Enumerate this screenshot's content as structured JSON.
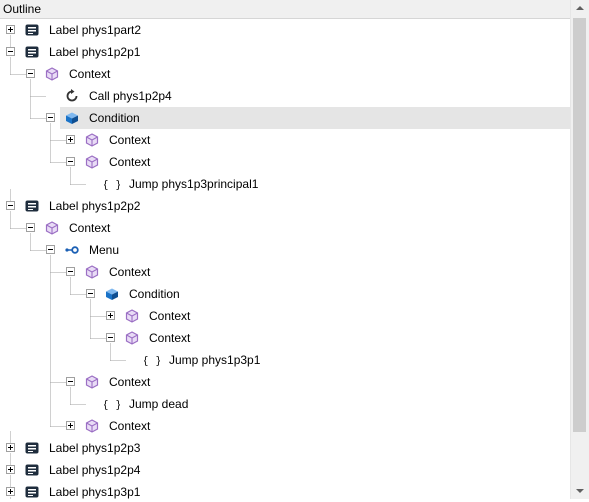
{
  "panel": {
    "title": "Outline"
  },
  "tree": {
    "rows": [
      {
        "label": "Label phys1part2",
        "icon": "label-icon",
        "expander": "plus",
        "depth": 0
      },
      {
        "label": "Label phys1p2p1",
        "icon": "label-icon",
        "expander": "minus",
        "depth": 0
      },
      {
        "label": "Context",
        "icon": "context-icon",
        "expander": "minus",
        "depth": 1
      },
      {
        "label": "Call phys1p2p4",
        "icon": "call-icon",
        "expander": "none",
        "depth": 2
      },
      {
        "label": "Condition",
        "icon": "condition-icon",
        "expander": "minus",
        "depth": 2,
        "selected": true
      },
      {
        "label": "Context",
        "icon": "context-icon",
        "expander": "plus",
        "depth": 3
      },
      {
        "label": "Context",
        "icon": "context-icon",
        "expander": "minus",
        "depth": 3
      },
      {
        "label": "Jump phys1p3principal1",
        "icon": "jump-icon",
        "expander": "none",
        "depth": 4
      },
      {
        "label": "Label phys1p2p2",
        "icon": "label-icon",
        "expander": "minus",
        "depth": 0
      },
      {
        "label": "Context",
        "icon": "context-icon",
        "expander": "minus",
        "depth": 1
      },
      {
        "label": "Menu",
        "icon": "menu-icon",
        "expander": "minus",
        "depth": 2
      },
      {
        "label": "Context",
        "icon": "context-icon",
        "expander": "minus",
        "depth": 3
      },
      {
        "label": "Condition",
        "icon": "condition-icon",
        "expander": "minus",
        "depth": 4
      },
      {
        "label": "Context",
        "icon": "context-icon",
        "expander": "plus",
        "depth": 5
      },
      {
        "label": "Context",
        "icon": "context-icon",
        "expander": "minus",
        "depth": 5
      },
      {
        "label": "Jump phys1p3p1",
        "icon": "jump-icon",
        "expander": "none",
        "depth": 6
      },
      {
        "label": "Context",
        "icon": "context-icon",
        "expander": "minus",
        "depth": 3
      },
      {
        "label": "Jump dead",
        "icon": "jump-icon",
        "expander": "none",
        "depth": 4
      },
      {
        "label": "Context",
        "icon": "context-icon",
        "expander": "plus",
        "depth": 3
      },
      {
        "label": "Label phys1p2p3",
        "icon": "label-icon",
        "expander": "plus",
        "depth": 0
      },
      {
        "label": "Label phys1p2p4",
        "icon": "label-icon",
        "expander": "plus",
        "depth": 0
      },
      {
        "label": "Label phys1p3p1",
        "icon": "label-icon",
        "expander": "plus",
        "depth": 0
      }
    ]
  },
  "colors": {
    "label_icon": "#1f2d3d",
    "context_icon": "#9b6fc4",
    "condition_icon": "#1a73c8",
    "menu_icon": "#1a5fb4",
    "selection": "#e5e5e5",
    "guide_line": "#a0a0a0"
  }
}
